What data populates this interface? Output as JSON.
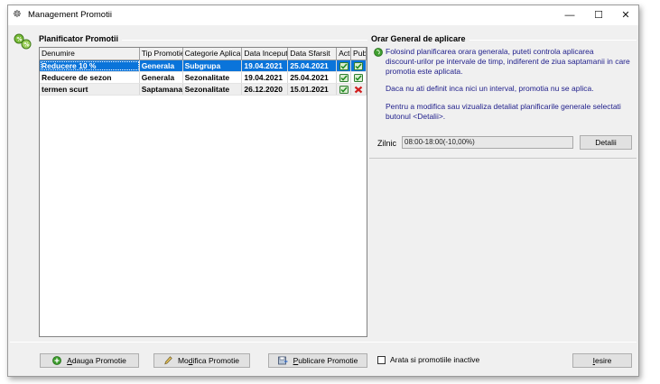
{
  "window": {
    "title": "Management Promotii",
    "minimize_glyph": "—",
    "maximize_glyph": "☐",
    "close_glyph": "✕"
  },
  "left_panel": {
    "title": "Planificator Promotii",
    "columns": [
      "Denumire",
      "Tip Promotie",
      "Categorie Aplicare",
      "Data Inceput",
      "Data Sfarsit",
      "Activ",
      "Publicat"
    ],
    "rows": [
      {
        "name": "Reducere 10 %",
        "tip": "Generala",
        "categorie": "Subgrupa",
        "inceput": "19.04.2021",
        "sfarsit": "25.04.2021",
        "activ_icon": "green-check-icon",
        "publicat_icon": "green-check-icon"
      },
      {
        "name": "Reducere de sezon",
        "tip": "Generala",
        "categorie": "Sezonalitate",
        "inceput": "19.04.2021",
        "sfarsit": "25.04.2021",
        "activ_icon": "green-check-icon",
        "publicat_icon": "green-check-icon"
      },
      {
        "name": "termen scurt",
        "tip": "Saptamanala",
        "categorie": "Sezonalitate",
        "inceput": "26.12.2020",
        "sfarsit": "15.01.2021",
        "activ_icon": "green-check-icon",
        "publicat_icon": "red-x-icon"
      }
    ]
  },
  "right_panel": {
    "title": "Orar General de aplicare",
    "info_line1": "Folosind planificarea orara generala, puteti controla aplicarea",
    "info_line2": "discount-urilor pe intervale de timp, indiferent de ziua saptamanii in care",
    "info_line3": "promotia este aplicata.",
    "info_para2": "Daca nu ati definit inca nici un interval, promotia nu se aplica.",
    "info_para3_line1": "Pentru a modifica sau vizualiza detaliat planificarile generale selectati",
    "info_para3_line2": "butonul <Detalii>.",
    "zilnic_label": "Zilnic",
    "zilnic_value": "08:00-18:00(-10,00%)",
    "detalii_button": "Detalii"
  },
  "footer": {
    "add_first": "A",
    "add_rest": "dauga Promotie",
    "mod_pre": "Mo",
    "mod_u": "d",
    "mod_rest": "ifica Promotie",
    "pub_u": "P",
    "pub_rest": "ublicare Promotie",
    "inactive_checkbox_label": "Arata si promotiile inactive",
    "exit_u": "I",
    "exit_rest": "esire"
  },
  "colors": {
    "selection": "#0a74da",
    "info_text": "#1e1d8a"
  }
}
